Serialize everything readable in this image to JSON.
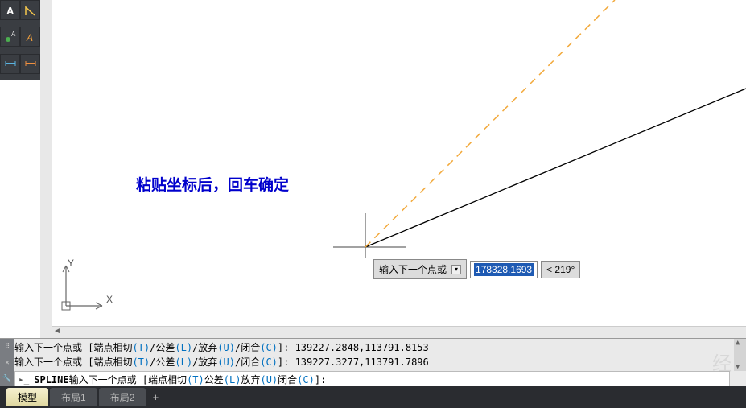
{
  "toolbar": {
    "items": [
      "text-tool",
      "angle-tool",
      "layer-green",
      "layer-orange",
      "dim-tool-1",
      "dim-tool-2"
    ]
  },
  "annotation": {
    "text": "粘贴坐标后，回车确定"
  },
  "axis": {
    "y_label": "Y",
    "x_label": "X"
  },
  "dynamic_input": {
    "prompt": "输入下一个点或",
    "value": "178328.1693",
    "angle": "< 219°"
  },
  "command": {
    "line1": {
      "prefix": "输入下一个点或 [端点相切",
      "t": "(T)",
      "mid1": "/公差",
      "l": "(L)",
      "mid2": "/放弃",
      "u": "(U)",
      "mid3": "/闭合",
      "c": "(C)",
      "suffix": "]: 139227.2848,113791.8153"
    },
    "line2": {
      "prefix": "输入下一个点或 [端点相切",
      "t": "(T)",
      "mid1": "/公差",
      "l": "(L)",
      "mid2": "/放弃",
      "u": "(U)",
      "mid3": "/闭合",
      "c": "(C)",
      "suffix": "]: 139227.3277,113791.7896"
    },
    "input": {
      "cmd": "SPLINE",
      "prefix": " 输入下一个点或 [端点相切",
      "t": "(T)",
      "mid1": " 公差",
      "l": "(L)",
      "mid2": " 放弃",
      "u": "(U)",
      "mid3": " 闭合",
      "c": "(C)",
      "suffix": "]:"
    }
  },
  "tabs": {
    "items": [
      {
        "label": "模型",
        "active": true
      },
      {
        "label": "布局1",
        "active": false
      },
      {
        "label": "布局2",
        "active": false
      }
    ],
    "add": "+"
  },
  "watermark": "经"
}
